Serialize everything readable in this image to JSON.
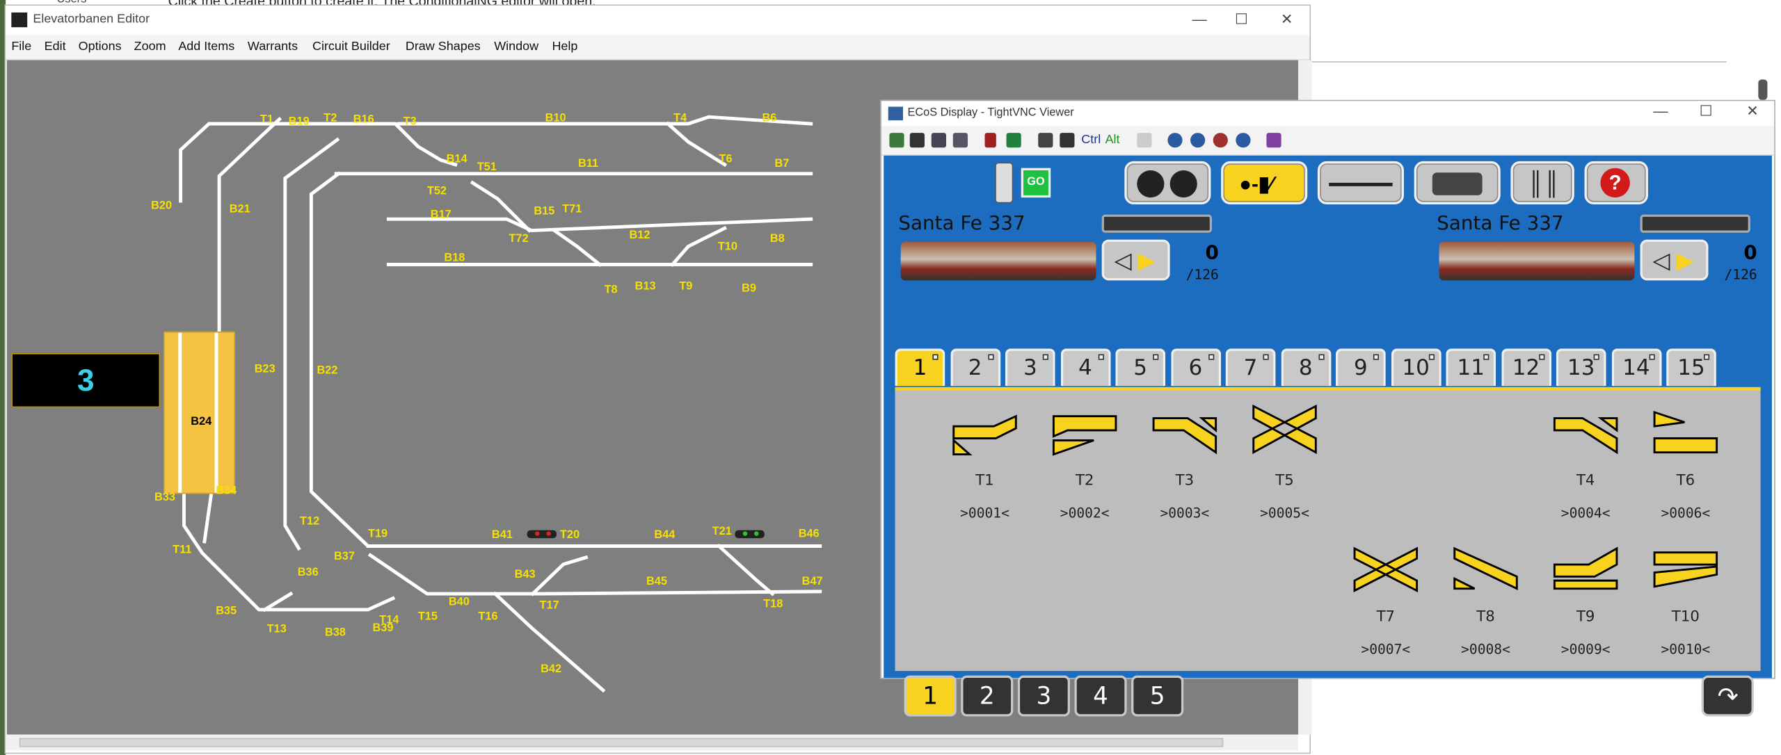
{
  "background": {
    "top_text": "Click the Create button to create it. The ConditionalNG editor will open.",
    "top_text_bold": "Create",
    "left_item": "Users"
  },
  "editor": {
    "title": "Elevatorbanen Editor",
    "menu": [
      "File",
      "Edit",
      "Options",
      "Zoom",
      "Add Items",
      "Warrants",
      "Circuit Builder",
      "Draw Shapes",
      "Window",
      "Help"
    ],
    "block_display": "3",
    "b24": "B24",
    "labels": [
      "T1",
      "B19",
      "T2",
      "B16",
      "T3",
      "B10",
      "T4",
      "B6",
      "T6",
      "B7",
      "B14",
      "T51",
      "B11",
      "T52",
      "B15",
      "T71",
      "B17",
      "T72",
      "B12",
      "T10",
      "B8",
      "B18",
      "T8",
      "B13",
      "T9",
      "B9",
      "B20",
      "B21",
      "B23",
      "B22",
      "B33",
      "B34",
      "T12",
      "T19",
      "B41",
      "T20",
      "B44",
      "T21",
      "B46",
      "T11",
      "B37",
      "B36",
      "B43",
      "B45",
      "B47",
      "B40",
      "T17",
      "T18",
      "B35",
      "T13",
      "T14",
      "B38",
      "B39",
      "T15",
      "T16",
      "B42"
    ]
  },
  "ecos": {
    "title": "ECoS Display - TightVNC Viewer",
    "toolbar_ctrl": "Ctrl",
    "toolbar_alt": "Alt",
    "go": "GO",
    "loco_left": {
      "name": "Santa Fe 337",
      "speed": "0",
      "max": "/126"
    },
    "loco_right": {
      "name": "Santa Fe 337",
      "speed": "0",
      "max": "/126"
    },
    "tabs": [
      "1",
      "2",
      "3",
      "4",
      "5",
      "6",
      "7",
      "8",
      "9",
      "10",
      "11",
      "12",
      "13",
      "14",
      "15"
    ],
    "active_tab": "1",
    "accessories": [
      {
        "name": "T1",
        "addr": ">0001<"
      },
      {
        "name": "T2",
        "addr": ">0002<"
      },
      {
        "name": "T3",
        "addr": ">0003<"
      },
      {
        "name": "T5",
        "addr": ">0005<"
      },
      {
        "name": "T4",
        "addr": ">0004<"
      },
      {
        "name": "T6",
        "addr": ">0006<"
      },
      {
        "name": "T7",
        "addr": ">0007<"
      },
      {
        "name": "T8",
        "addr": ">0008<"
      },
      {
        "name": "T9",
        "addr": ">0009<"
      },
      {
        "name": "T10",
        "addr": ">0010<"
      }
    ],
    "pages": [
      "1",
      "2",
      "3",
      "4",
      "5"
    ],
    "colors": {
      "accent": "#f7d21e",
      "display_bg": "#1c6cbf",
      "track_label": "#f5e000"
    }
  }
}
